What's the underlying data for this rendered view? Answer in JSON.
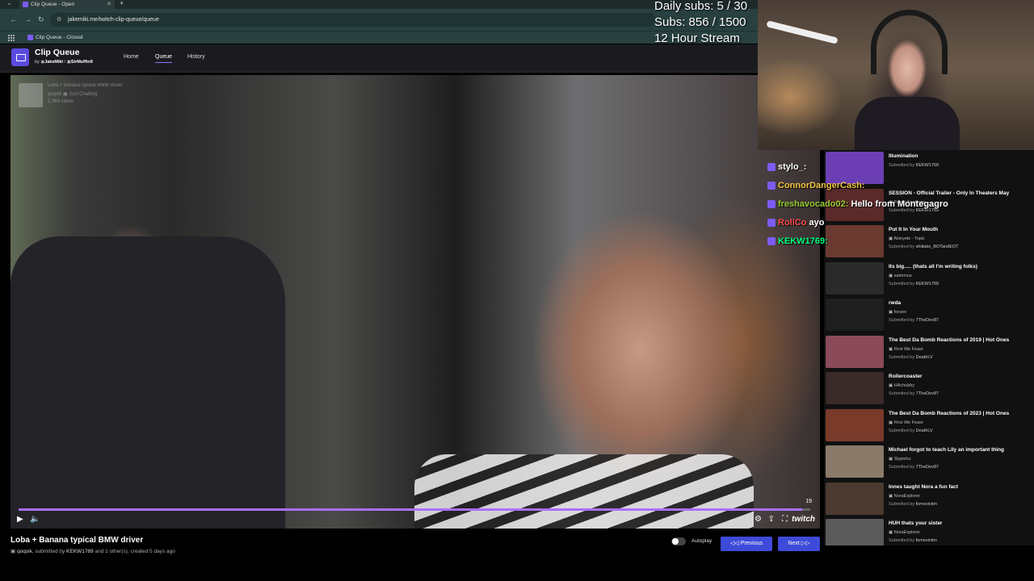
{
  "browser": {
    "tab_title": "Clip Queue - Open",
    "url": "jakemiki.me/twitch-clip-queue/queue",
    "bookmark": "Clip Queue - Closed"
  },
  "overlay": {
    "daily_subs": "Daily subs: 5 / 30",
    "subs": "Subs: 856 / 1500",
    "stream": "12 Hour Stream"
  },
  "app": {
    "title": "Clip Queue",
    "by_prefix": "by",
    "author1": "JakeMiki",
    "separator": "/",
    "author2": "SirMuffin9",
    "nav": [
      "Home",
      "Queue",
      "History"
    ]
  },
  "video": {
    "info_title": "Loba + Banana typical BMW driver",
    "info_channel": "qoqsik",
    "info_category": "Just Chatting",
    "info_views": "1,363 views",
    "time_badge": "19",
    "watermark": "twitch",
    "progress": 0.99
  },
  "clip": {
    "title": "Loba + Banana typical BMW driver",
    "channel": "qoqsik",
    "meta": ", submitted by ",
    "submitter": "KEKW1769",
    "meta_tail": " and 1 other(s), created 5 days ago"
  },
  "controls": {
    "autoplay": "Autoplay",
    "previous": "Previous",
    "next": "Next"
  },
  "chat": [
    {
      "user": "stylo_:",
      "color": "#ffffff",
      "message": ""
    },
    {
      "user": "ConnorDangerCash:",
      "color": "#f4c542",
      "message": ""
    },
    {
      "user": "freshavocado02:",
      "color": "#9acd32",
      "message": "Hello from Montegagro"
    },
    {
      "user": "RollCo",
      "color": "#ff4d4d",
      "message": "ayo"
    },
    {
      "user": "KEKW1769:",
      "color": "#00ff7f",
      "message": ""
    }
  ],
  "queue": [
    {
      "title": "Illumination",
      "channel": "",
      "submitter": "KEKW1769",
      "color": "#6b3fb3"
    },
    {
      "title": "SESSION - Official Trailer - Only In Theaters May",
      "channel": "Focus Features",
      "submitter": "KEKW1769",
      "color": "#5a2a2a"
    },
    {
      "title": "Put It In Your Mouth",
      "channel": "Akinyele - Topic",
      "submitter": "shiitake_BOTandEOT",
      "color": "#6a3a30"
    },
    {
      "title": "Its big..... (thats all I'm writing folks)",
      "channel": "saimmus",
      "submitter": "KEKW1769",
      "color": "#2a2a2a"
    },
    {
      "title": "rwda",
      "channel": "forsen",
      "submitter": "7TheDev87",
      "color": "#1e1e1e"
    },
    {
      "title": "The Best Da Bomb Reactions of 2019 | Hot Ones",
      "channel": "First We Feast",
      "submitter": "DeathLV",
      "color": "#8a4a5a"
    },
    {
      "title": "Rollercoaster",
      "channel": "HAchubby",
      "submitter": "7TheDev87",
      "color": "#3a2a2a"
    },
    {
      "title": "The Best Da Bomb Reactions of 2023 | Hot Ones",
      "channel": "First We Feast",
      "submitter": "DeathLV",
      "color": "#7a3a2a"
    },
    {
      "title": "Michael forgot to teach Lily an important thing",
      "channel": "Slypichu",
      "submitter": "7TheDev87",
      "color": "#8a7a6a"
    },
    {
      "title": "Innes taught Nora a fun fact",
      "channel": "NoraExplorer",
      "submitter": "fomovictim",
      "color": "#4a3a30"
    },
    {
      "title": "HUH thats your sister",
      "channel": "NoraExplorer",
      "submitter": "fomovictim",
      "color": "#5a5a5a"
    }
  ],
  "queue_submitted_label": "Submitted by"
}
